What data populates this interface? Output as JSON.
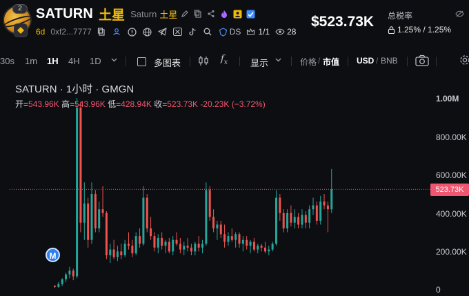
{
  "header": {
    "logo_badge": "2",
    "symbol": "SATURN",
    "name_cn": "土星",
    "subname": "Saturn",
    "subname_cn": "土星",
    "age": "6d",
    "address": "0xf2...7777",
    "ds_label": "DS",
    "ratio": "1/1",
    "holders": "28",
    "price": "$523.73K",
    "tax_label": "总税率",
    "tax_value": "1.25% / 1.25%"
  },
  "toolbar": {
    "intervals": [
      "30s",
      "1m",
      "1H",
      "4H",
      "1D"
    ],
    "active_interval": "1H",
    "multi_chart": "多图表",
    "display": "显示",
    "price_label": "价格",
    "mcap_label": "市值",
    "currency": "USD",
    "currency_alt": "BNB"
  },
  "chart": {
    "title": "SATURN · 1小时 · GMGN",
    "ohlc": {
      "open_label": "开=",
      "open": "543.96K",
      "high_label": "高=",
      "high": "543.96K",
      "low_label": "低=",
      "low": "428.94K",
      "close_label": "收=",
      "close": "523.73K",
      "change": "-20.23K",
      "change_pct": "(−3.72%)"
    },
    "axis": [
      "1.00M",
      "800.00K",
      "600.00K",
      "400.00K",
      "200.00K",
      "0"
    ],
    "current_tag": "523.73K",
    "marker": "M"
  },
  "colors": {
    "up": "#26a69a",
    "down": "#ef5350",
    "accent": "#f0b90b",
    "background": "#0d0e12"
  },
  "chart_data": {
    "type": "candlestick",
    "title": "SATURN · 1小时 · GMGN",
    "ylim": [
      0,
      1000000
    ],
    "y_ticks": [
      0,
      200000,
      400000,
      600000,
      800000,
      1000000
    ],
    "last_price": 523730,
    "candles": [
      [
        20000,
        25000,
        10000,
        15000
      ],
      [
        15000,
        40000,
        10000,
        30000
      ],
      [
        30000,
        60000,
        20000,
        55000
      ],
      [
        55000,
        90000,
        40000,
        80000
      ],
      [
        80000,
        120000,
        60000,
        100000
      ],
      [
        100000,
        110000,
        50000,
        70000
      ],
      [
        70000,
        1000000,
        60000,
        950000
      ],
      [
        950000,
        980000,
        300000,
        350000
      ],
      [
        350000,
        560000,
        260000,
        450000
      ],
      [
        450000,
        480000,
        220000,
        260000
      ],
      [
        260000,
        560000,
        240000,
        500000
      ],
      [
        500000,
        520000,
        300000,
        320000
      ],
      [
        320000,
        460000,
        300000,
        420000
      ],
      [
        420000,
        540000,
        380000,
        400000
      ],
      [
        400000,
        410000,
        160000,
        180000
      ],
      [
        180000,
        240000,
        140000,
        210000
      ],
      [
        210000,
        260000,
        160000,
        170000
      ],
      [
        170000,
        230000,
        150000,
        200000
      ],
      [
        200000,
        240000,
        160000,
        180000
      ],
      [
        180000,
        260000,
        170000,
        240000
      ],
      [
        240000,
        300000,
        210000,
        230000
      ],
      [
        230000,
        260000,
        170000,
        190000
      ],
      [
        190000,
        300000,
        180000,
        280000
      ],
      [
        280000,
        320000,
        220000,
        240000
      ],
      [
        240000,
        540000,
        230000,
        480000
      ],
      [
        480000,
        500000,
        300000,
        320000
      ],
      [
        320000,
        380000,
        260000,
        280000
      ],
      [
        280000,
        300000,
        200000,
        220000
      ],
      [
        220000,
        290000,
        190000,
        270000
      ],
      [
        270000,
        300000,
        210000,
        230000
      ],
      [
        230000,
        260000,
        190000,
        250000
      ],
      [
        250000,
        270000,
        190000,
        200000
      ],
      [
        200000,
        280000,
        180000,
        260000
      ],
      [
        260000,
        300000,
        230000,
        240000
      ],
      [
        240000,
        270000,
        190000,
        210000
      ],
      [
        210000,
        250000,
        180000,
        230000
      ],
      [
        230000,
        270000,
        200000,
        220000
      ],
      [
        220000,
        240000,
        180000,
        200000
      ],
      [
        200000,
        250000,
        180000,
        240000
      ],
      [
        240000,
        280000,
        200000,
        220000
      ],
      [
        220000,
        260000,
        190000,
        240000
      ],
      [
        240000,
        560000,
        230000,
        520000
      ],
      [
        520000,
        540000,
        360000,
        380000
      ],
      [
        380000,
        420000,
        300000,
        320000
      ],
      [
        320000,
        360000,
        260000,
        340000
      ],
      [
        340000,
        360000,
        270000,
        290000
      ],
      [
        290000,
        340000,
        220000,
        250000
      ],
      [
        250000,
        300000,
        230000,
        280000
      ],
      [
        280000,
        320000,
        250000,
        260000
      ],
      [
        260000,
        300000,
        220000,
        290000
      ],
      [
        290000,
        300000,
        220000,
        240000
      ],
      [
        240000,
        280000,
        200000,
        260000
      ],
      [
        260000,
        280000,
        210000,
        230000
      ],
      [
        230000,
        260000,
        190000,
        250000
      ],
      [
        250000,
        270000,
        200000,
        210000
      ],
      [
        210000,
        240000,
        190000,
        230000
      ],
      [
        230000,
        240000,
        200000,
        220000
      ],
      [
        220000,
        250000,
        190000,
        200000
      ],
      [
        200000,
        230000,
        180000,
        210000
      ],
      [
        210000,
        250000,
        200000,
        240000
      ],
      [
        240000,
        520000,
        230000,
        480000
      ],
      [
        480000,
        500000,
        360000,
        400000
      ],
      [
        400000,
        420000,
        300000,
        320000
      ],
      [
        320000,
        420000,
        300000,
        400000
      ],
      [
        400000,
        440000,
        330000,
        350000
      ],
      [
        350000,
        420000,
        320000,
        380000
      ],
      [
        380000,
        400000,
        320000,
        340000
      ],
      [
        340000,
        420000,
        320000,
        390000
      ],
      [
        390000,
        410000,
        320000,
        350000
      ],
      [
        350000,
        440000,
        320000,
        420000
      ],
      [
        420000,
        480000,
        390000,
        440000
      ],
      [
        440000,
        460000,
        340000,
        360000
      ],
      [
        360000,
        490000,
        340000,
        460000
      ],
      [
        460000,
        500000,
        420000,
        440000
      ],
      [
        440000,
        460000,
        300000,
        420000
      ],
      [
        420000,
        630000,
        400000,
        524000
      ]
    ]
  }
}
